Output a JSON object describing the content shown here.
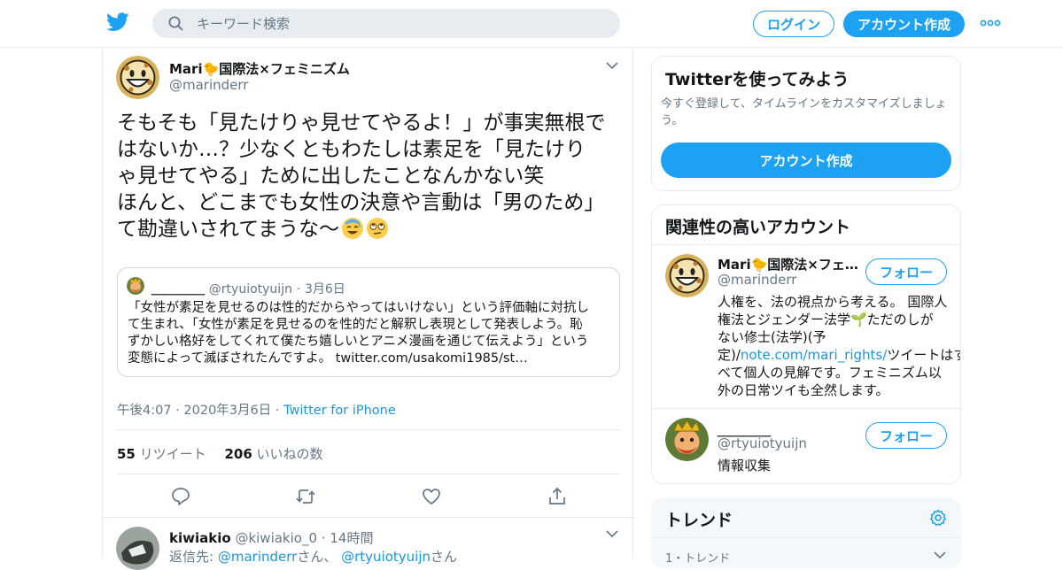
{
  "header": {
    "search_placeholder": "キーワード検索",
    "login_label": "ログイン",
    "signup_label": "アカウント作成"
  },
  "tweet": {
    "author_name": "Mari🐤国際法×フェミニズム",
    "author_handle": "@marinderr",
    "lines": [
      "そもそも「見たけりゃ見せてやるよ！」が事実無根で",
      "はないか…？少なくともわたしは素足を「見たけり",
      "ゃ見せてやる」ために出したことなんかない笑",
      "ほんと、どこまでも女性の決意や言動は「男のため」",
      "て勘違いされてまうな〜"
    ],
    "quote": {
      "author_name": "＿＿＿＿",
      "author_handle": "@rtyuiotyuijn",
      "dot": "·",
      "date": "3月6日",
      "lines": [
        "「女性が素足を見せるのは性的だからやってはいけない」という評価軸に対抗し",
        "て生まれ、「女性が素足を見せるのを性的だと解釈し表現として発表しよう。恥",
        "ずかしい格好をしてくれて僕たち嬉しいとアニメ漫画を通じて伝えよう」という",
        "変態によって滅ぼされたんですよ。 twitter.com/usakomi1985/st…"
      ]
    },
    "timestamp": "午後4:07 · 2020年3月6日 ·",
    "source": "Twitter for iPhone",
    "retweet_count": "55",
    "retweet_label": "リツイート",
    "like_count": "206",
    "like_label": "いいねの数"
  },
  "reply": {
    "author_name": "kiwiakio",
    "author_handle": "@kiwiakio_0",
    "dot": "·",
    "time": "14時間",
    "reply_to_label": "返信先:",
    "reply_to_1": "@marinderr",
    "reply_to_sep": "さん、",
    "reply_to_2": "@rtyuiotyuijn",
    "reply_to_end": "さん"
  },
  "signup_card": {
    "title": "Twitterを使ってみよう",
    "desc_line1": "今すぐ登録して、タイムラインをカスタマイズしましょ",
    "desc_line2": "う。",
    "button_label": "アカウント作成"
  },
  "related": {
    "title": "関連性の高いアカウント",
    "follow_label": "フォロー",
    "accounts": [
      {
        "name": "Mari🐤国際法×フェ…",
        "handle": "@marinderr",
        "bio_line1": "人権を、法の視点から考える。 国際人",
        "bio_line2": "権法とジェンダー法学🌱ただのしが",
        "bio_line3": "ない修士(法学)(予",
        "bio_line4_pre": "定)/",
        "bio_link": "note.com/mari_rights/",
        "bio_line4_post": "ツイートはす",
        "bio_line5": "べて個人の見解です。フェミニズム以",
        "bio_line6": "外の日常ツイも全然します。"
      },
      {
        "name": "＿＿＿＿",
        "handle": "@rtyuiotyuijn",
        "bio": "情報収集"
      }
    ]
  },
  "trends": {
    "title": "トレンド",
    "first_item": "1・トレンド"
  },
  "colors": {
    "accent": "#1da1f2",
    "link": "#1b95e0",
    "muted": "#657786",
    "border": "#e6ecf0"
  }
}
